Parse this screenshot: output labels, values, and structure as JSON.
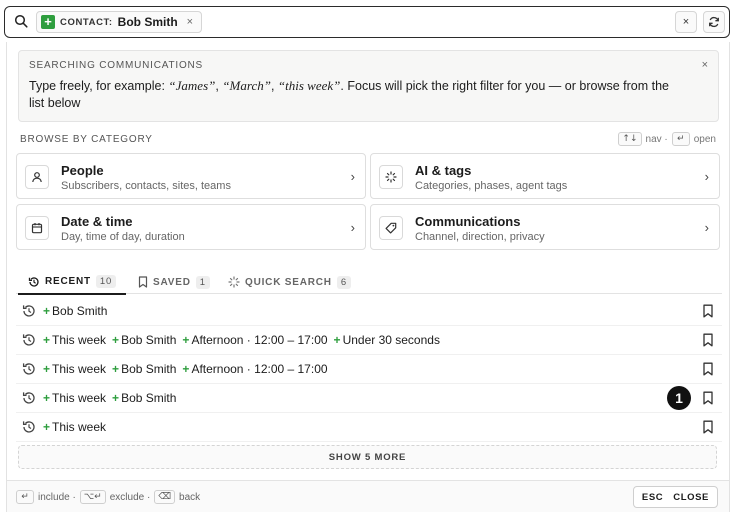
{
  "search": {
    "chip_key": "CONTACT:",
    "chip_value": "Bob Smith",
    "chip_remove": "×",
    "clear_label": "×"
  },
  "info": {
    "title": "SEARCHING COMMUNICATIONS",
    "text_prefix": "Type freely, for example: ",
    "ex1": "“James”",
    "sep1": ", ",
    "ex2": "“March”",
    "sep2": ", ",
    "ex3": "“this week”",
    "text_suffix": ". Focus will pick the right filter for you — or browse from the list below",
    "close": "×"
  },
  "categories": {
    "heading": "BROWSE BY CATEGORY",
    "nav_key": "↑↓",
    "nav_label": "nav ·",
    "open_key": "↵",
    "open_label": "open",
    "items": [
      {
        "title": "People",
        "sub": "Subscribers, contacts, sites, teams",
        "icon": "person-icon"
      },
      {
        "title": "AI & tags",
        "sub": "Categories, phases, agent tags",
        "icon": "sparkle-icon"
      },
      {
        "title": "Date & time",
        "sub": "Day, time of day, duration",
        "icon": "calendar-icon"
      },
      {
        "title": "Communications",
        "sub": "Channel, direction, privacy",
        "icon": "tag-icon"
      }
    ]
  },
  "tabs": [
    {
      "label": "RECENT",
      "count": "10",
      "icon": "history-icon",
      "active": true
    },
    {
      "label": "SAVED",
      "count": "1",
      "icon": "bookmark-icon",
      "active": false
    },
    {
      "label": "QUICK SEARCH",
      "count": "6",
      "icon": "spinner-icon",
      "active": false
    }
  ],
  "recent": [
    [
      "Bob Smith"
    ],
    [
      "This week",
      "Bob Smith",
      "Afternoon · 12:00 – 17:00",
      "Under 30 seconds"
    ],
    [
      "This week",
      "Bob Smith",
      "Afternoon · 12:00 – 17:00"
    ],
    [
      "This week",
      "Bob Smith"
    ],
    [
      "This week"
    ]
  ],
  "annotation_badge": "1",
  "show_more": "SHOW 5 MORE",
  "footer": {
    "include_key": "↵",
    "include_label": "include ·",
    "exclude_key": "⌥↵",
    "exclude_label": "exclude ·",
    "back_key": "⌫",
    "back_label": "back",
    "esc": "ESC",
    "close": "CLOSE"
  },
  "colors": {
    "accent_green": "#2e9e3e",
    "border_dark": "#2b2b2b"
  }
}
